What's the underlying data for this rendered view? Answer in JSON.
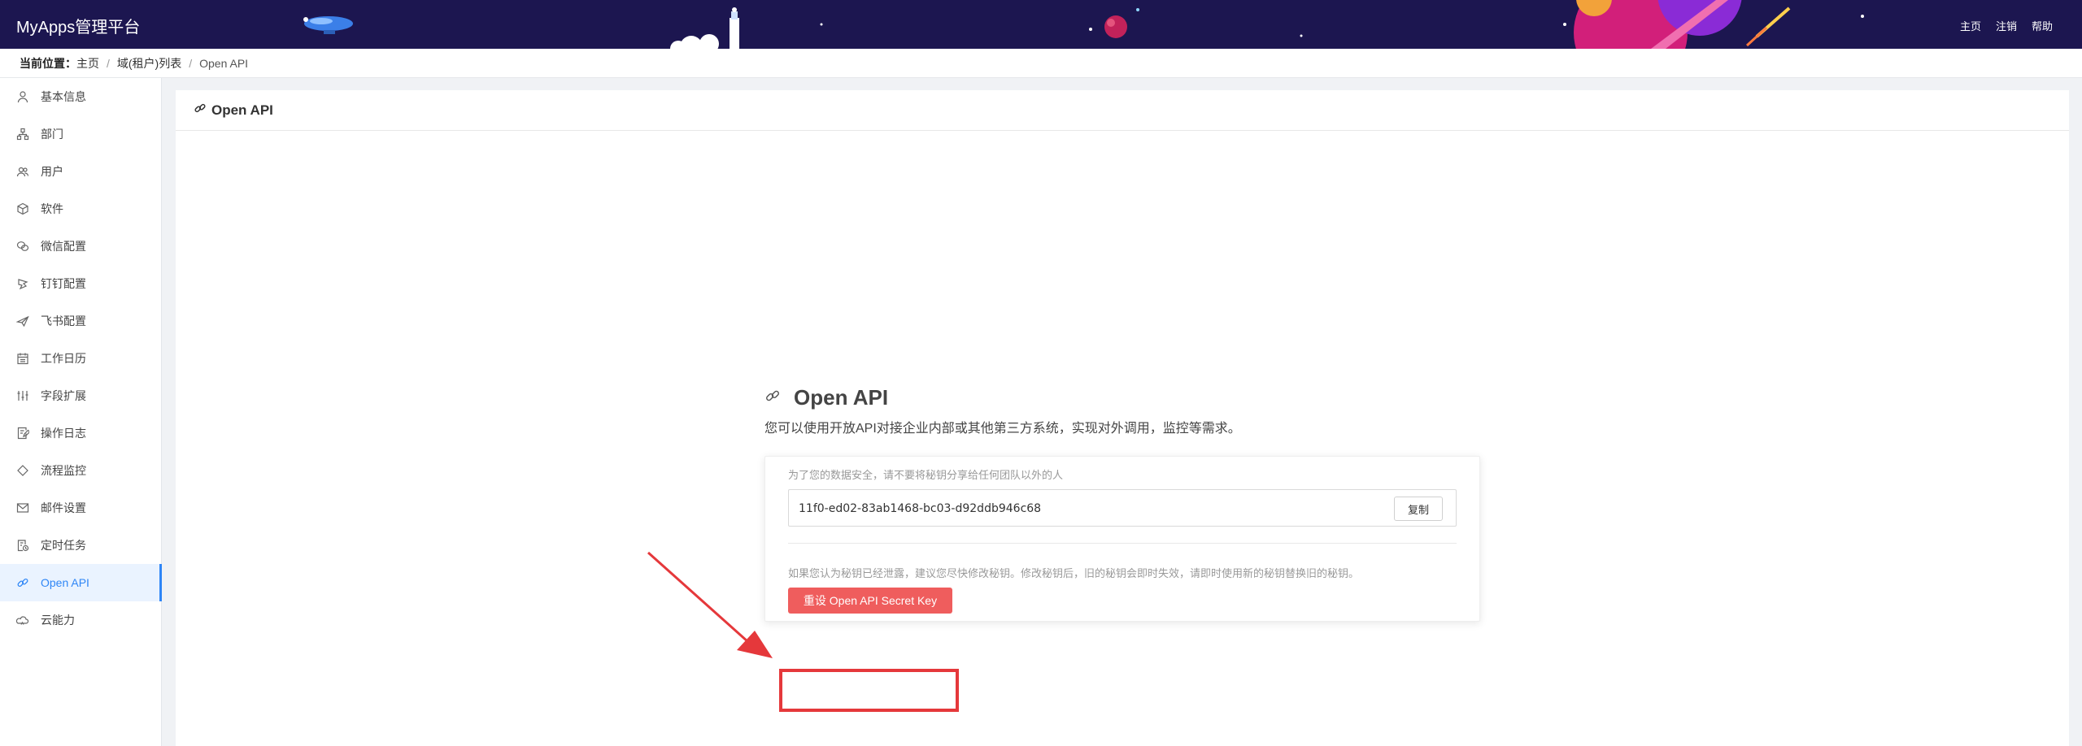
{
  "app": {
    "title": "MyApps管理平台"
  },
  "topnav": [
    {
      "label": "主页"
    },
    {
      "label": "注销"
    },
    {
      "label": "帮助"
    }
  ],
  "breadcrumb": {
    "lead": "当前位置：",
    "items": [
      "主页",
      "域(租户)列表",
      "Open API"
    ]
  },
  "sidebar": {
    "items": [
      {
        "label": "基本信息",
        "icon": "user-icon"
      },
      {
        "label": "部门",
        "icon": "org-icon"
      },
      {
        "label": "用户",
        "icon": "users-icon"
      },
      {
        "label": "软件",
        "icon": "cube-icon"
      },
      {
        "label": "微信配置",
        "icon": "wechat-icon"
      },
      {
        "label": "钉钉配置",
        "icon": "dingtalk-icon"
      },
      {
        "label": "飞书配置",
        "icon": "feishu-icon"
      },
      {
        "label": "工作日历",
        "icon": "calendar-icon"
      },
      {
        "label": "字段扩展",
        "icon": "sliders-icon"
      },
      {
        "label": "操作日志",
        "icon": "log-icon"
      },
      {
        "label": "流程监控",
        "icon": "diamond-icon"
      },
      {
        "label": "邮件设置",
        "icon": "mail-icon"
      },
      {
        "label": "定时任务",
        "icon": "task-icon"
      },
      {
        "label": "Open API",
        "icon": "link-icon",
        "active": true
      },
      {
        "label": "云能力",
        "icon": "cloud-icon"
      }
    ]
  },
  "panel": {
    "title": "Open API"
  },
  "openapi": {
    "title": "Open API",
    "description": "您可以使用开放API对接企业内部或其他第三方系统，实现对外调用，监控等需求。",
    "security_hint": "为了您的数据安全，请不要将秘钥分享给任何团队以外的人",
    "secret_key": "11f0-ed02-83ab1468-bc03-d92ddb946c68",
    "copy_label": "复制",
    "reset_hint": "如果您认为秘钥已经泄露，建议您尽快修改秘钥。修改秘钥后，旧的秘钥会即时失效，请即时使用新的秘钥替换旧的秘钥。",
    "reset_label": "重设 Open API Secret Key"
  },
  "colors": {
    "header_bg": "#1c1650",
    "accent": "#2f86f6",
    "danger_button": "#ef5d5d",
    "annotation": "#e5383b"
  }
}
